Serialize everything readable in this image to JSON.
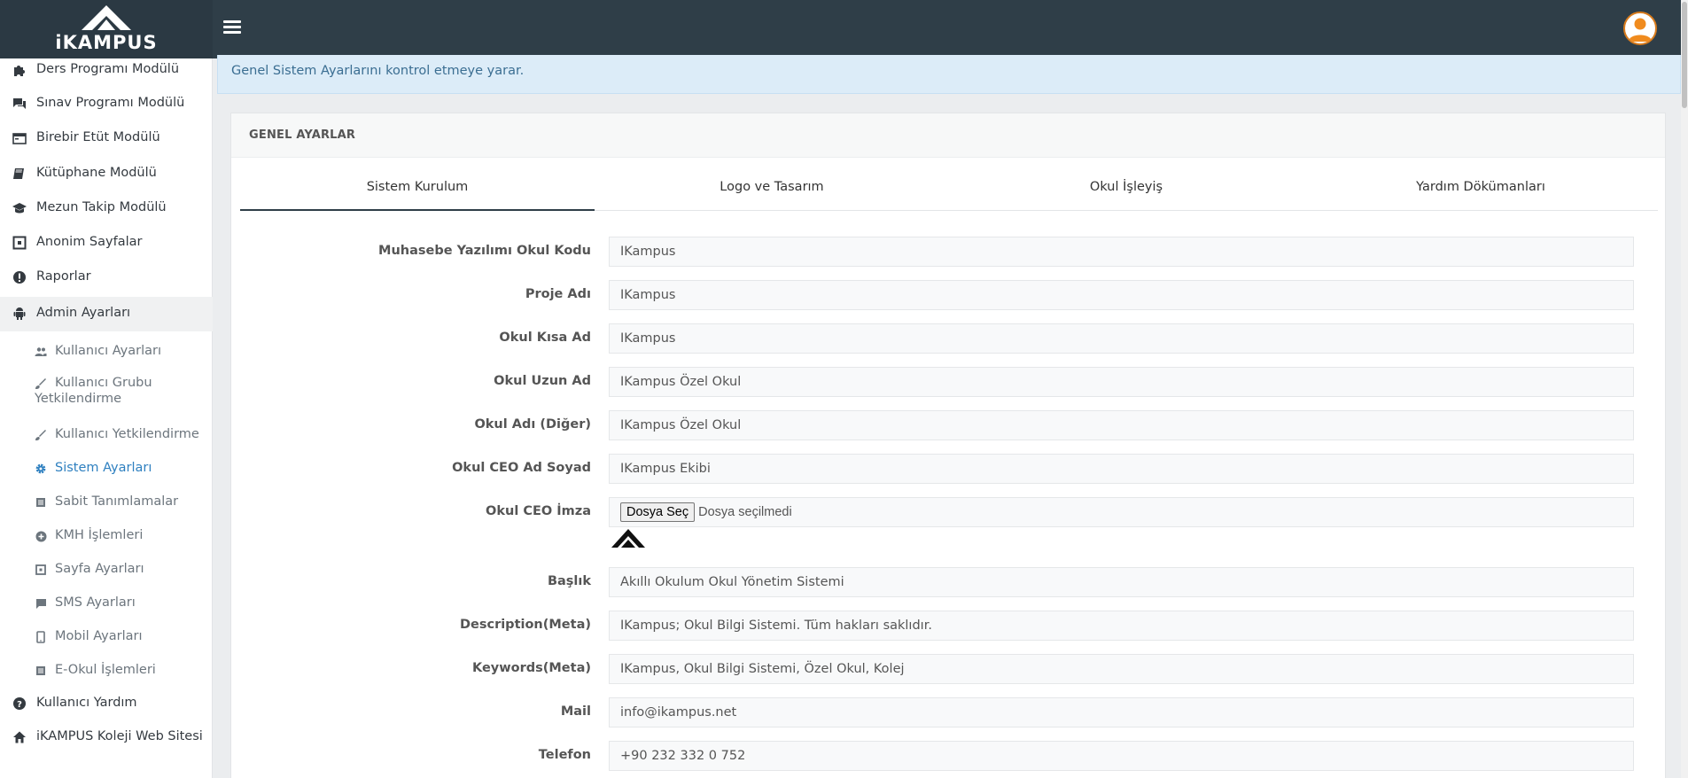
{
  "brand": {
    "name": "iKAMPUS"
  },
  "sidebar": {
    "items": [
      {
        "label": "Ders Programı Modülü",
        "icon": "puzzle-icon"
      },
      {
        "label": "Sınav Programı Modülü",
        "icon": "chat-icon"
      },
      {
        "label": "Birebir Etüt Modülü",
        "icon": "calendar-icon"
      },
      {
        "label": "Kütüphane Modülü",
        "icon": "book-icon"
      },
      {
        "label": "Mezun Takip Modülü",
        "icon": "graduation-cap-icon"
      },
      {
        "label": "Anonim Sayfalar",
        "icon": "grid-icon"
      },
      {
        "label": "Raporlar",
        "icon": "alert-icon"
      },
      {
        "label": "Admin Ayarları",
        "icon": "android-icon"
      }
    ],
    "sub_items": [
      {
        "label": "Kullanıcı Ayarları",
        "icon": "users-icon"
      },
      {
        "label": "Kullanıcı Grubu Yetkilendirme",
        "icon": "brush-icon"
      },
      {
        "label": "Kullanıcı Yetkilendirme",
        "icon": "brush-icon"
      },
      {
        "label": "Sistem Ayarları",
        "icon": "gear-icon"
      },
      {
        "label": "Sabit Tanımlamalar",
        "icon": "list-icon"
      },
      {
        "label": "KMH İşlemleri",
        "icon": "plus-circle-icon"
      },
      {
        "label": "Sayfa Ayarları",
        "icon": "grid-icon"
      },
      {
        "label": "SMS Ayarları",
        "icon": "message-icon"
      },
      {
        "label": "Mobil Ayarları",
        "icon": "mobile-icon"
      },
      {
        "label": "E-Okul İşlemleri",
        "icon": "list-icon"
      }
    ],
    "bottom_items": [
      {
        "label": "Kullanıcı Yardım",
        "icon": "help-icon"
      },
      {
        "label": "iKAMPUS Koleji Web Sitesi",
        "icon": "home-icon"
      }
    ]
  },
  "info": {
    "text": "Genel Sistem Ayarlarını kontrol etmeye yarar."
  },
  "card": {
    "title": "GENEL AYARLAR"
  },
  "tabs": [
    "Sistem Kurulum",
    "Logo ve Tasarım",
    "Okul İşleyiş",
    "Yardım Dökümanları"
  ],
  "form": {
    "school_code_label": "Muhasebe Yazılımı Okul Kodu",
    "school_code": "IKampus",
    "project_label": "Proje Adı",
    "project": "IKampus",
    "short_name_label": "Okul Kısa Ad",
    "short_name": "IKampus",
    "long_name_label": "Okul Uzun Ad",
    "long_name": "IKampus Özel Okul",
    "other_name_label": "Okul Adı (Diğer)",
    "other_name": "IKampus Özel Okul",
    "ceo_label": "Okul CEO Ad Soyad",
    "ceo": "IKampus Ekibi",
    "signature_label": "Okul CEO İmza",
    "file_button": "Dosya Seç",
    "file_status": "Dosya seçilmedi",
    "title_label": "Başlık",
    "title": "Akıllı Okulum Okul Yönetim Sistemi",
    "description_label": "Description(Meta)",
    "description": "IKampus; Okul Bilgi Sistemi. Tüm hakları saklıdır.",
    "keywords_label": "Keywords(Meta)",
    "keywords": "IKampus, Okul Bilgi Sistemi, Özel Okul, Kolej",
    "mail_label": "Mail",
    "mail": "info@ikampus.net",
    "phone_label": "Telefon",
    "phone": "+90 232 332 0 752"
  }
}
